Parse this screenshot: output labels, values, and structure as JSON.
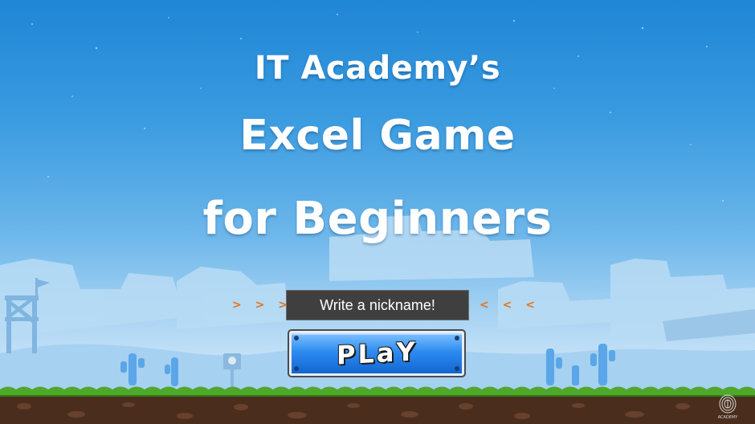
{
  "title": {
    "line1": "IT Academy’s",
    "line2": "Excel Game",
    "line3": "for Beginners"
  },
  "nickname": {
    "placeholder": "Write a nickname!",
    "value": "",
    "arrows_left": "> > >",
    "arrows_right": "< < <"
  },
  "play_button": {
    "label": "PLaY"
  },
  "logo": {
    "text": "ACADEMY"
  },
  "colors": {
    "sky_top": "#1f86d6",
    "arrow_orange": "#e8731a",
    "input_bg": "#3f3f3f",
    "button_blue": "#2d8cf0",
    "grass": "#4fa82a",
    "soil": "#4a2d1c"
  }
}
